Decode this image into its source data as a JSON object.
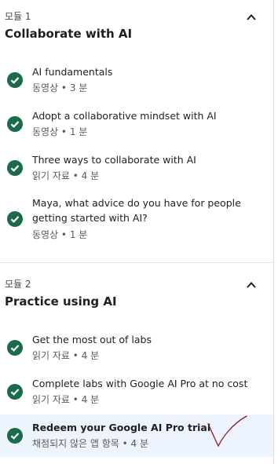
{
  "modules": [
    {
      "number": "모듈 1",
      "title": "Collaborate with AI",
      "items": [
        {
          "title": "AI fundamentals",
          "meta": "동영상 • 3 분"
        },
        {
          "title": "Adopt a collaborative mindset with AI",
          "meta": "동영상 • 1 분"
        },
        {
          "title": "Three ways to collaborate with AI",
          "meta": "읽기 자료 • 4 분"
        },
        {
          "title": "Maya, what advice do you have for people getting started with AI?",
          "meta": "동영상 • 1 분"
        }
      ]
    },
    {
      "number": "모듈 2",
      "title": "Practice using AI",
      "items": [
        {
          "title": "Get the most out of labs",
          "meta": "읽기 자료 • 4 분"
        },
        {
          "title": "Complete labs with Google AI Pro at no cost",
          "meta": "읽기 자료 • 4 분"
        },
        {
          "title": "Redeem your Google AI Pro trial",
          "meta": "채점되지 않은 앱 항목 • 4 분"
        }
      ]
    }
  ],
  "colors": {
    "check": "#1b6b4a",
    "active_bg": "#eef4fd",
    "scribble": "#8b1a2a"
  },
  "icons": {
    "completed": "check-circle-icon",
    "collapse": "chevron-up-icon"
  }
}
